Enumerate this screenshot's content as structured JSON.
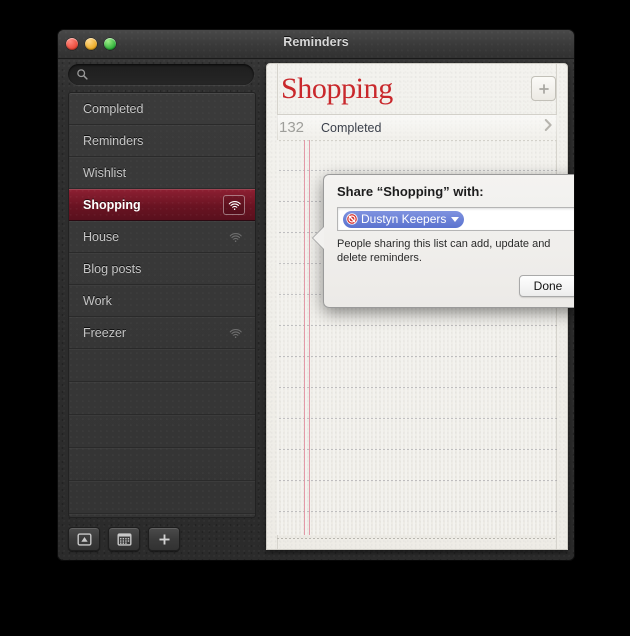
{
  "window": {
    "title": "Reminders",
    "traffic_lights": [
      {
        "name": "close",
        "color": "#e8402f"
      },
      {
        "name": "minimize",
        "color": "#e9a316"
      },
      {
        "name": "zoom",
        "color": "#1fa72f"
      }
    ]
  },
  "search": {
    "value": "",
    "placeholder": "",
    "icon": "search-icon"
  },
  "sidebar": {
    "items": [
      {
        "label": "Completed",
        "selected": false,
        "shared": false
      },
      {
        "label": "Reminders",
        "selected": false,
        "shared": false
      },
      {
        "label": "Wishlist",
        "selected": false,
        "shared": false
      },
      {
        "label": "Shopping",
        "selected": true,
        "shared": true
      },
      {
        "label": "House",
        "selected": false,
        "shared": true
      },
      {
        "label": "Blog posts",
        "selected": false,
        "shared": false
      },
      {
        "label": "Work",
        "selected": false,
        "shared": false
      },
      {
        "label": "Freezer",
        "selected": false,
        "shared": true
      }
    ],
    "selected_color": "#6a1322",
    "toolbar": [
      {
        "name": "show-calendar-drawer-button",
        "icon": "drawer-icon"
      },
      {
        "name": "calendar-button",
        "icon": "calendar-icon"
      },
      {
        "name": "add-list-button",
        "icon": "plus-icon"
      }
    ]
  },
  "main": {
    "title": "Shopping",
    "title_color": "#c9282c",
    "add_button_icon": "plus-icon",
    "completed": {
      "count": "132",
      "label": "Completed",
      "chevron": "chevron-right-icon"
    }
  },
  "popover": {
    "title": "Share “Shopping” with:",
    "token": {
      "name": "Dustyn Keepers",
      "status_icon": "blocked-icon",
      "caret_icon": "chevron-down-icon",
      "color": "#5a72cf"
    },
    "description": "People sharing this list can add, update and delete reminders.",
    "done_label": "Done"
  }
}
